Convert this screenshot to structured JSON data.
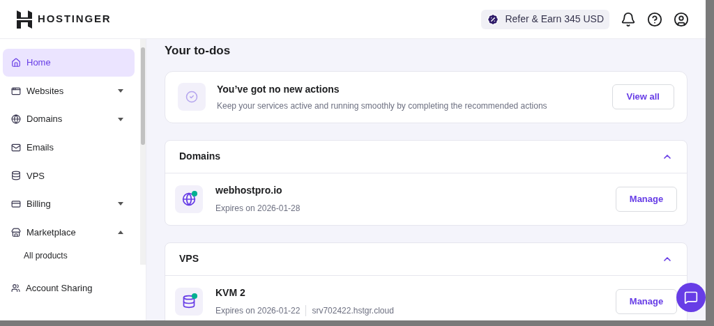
{
  "header": {
    "brand": "HOSTINGER",
    "referral": "Refer & Earn 345 USD"
  },
  "sidebar": {
    "items": [
      {
        "label": "Home",
        "selected": true
      },
      {
        "label": "Websites",
        "selected": false,
        "expanded": false
      },
      {
        "label": "Domains",
        "selected": false,
        "expanded": false
      },
      {
        "label": "Emails",
        "selected": false
      },
      {
        "label": "VPS",
        "selected": false
      },
      {
        "label": "Billing",
        "selected": false,
        "expanded": false
      },
      {
        "label": "Marketplace",
        "selected": false,
        "expanded": true,
        "children": [
          {
            "label": "All products",
            "selected": false
          }
        ]
      }
    ],
    "footer_item": {
      "label": "Account Sharing",
      "selected": false
    }
  },
  "main": {
    "heading": "Your to-dos",
    "todo": {
      "title": "You’ve got no new actions",
      "text": "Keep your services active and running smoothly by completing the recommended actions",
      "button": "View all"
    },
    "sections": [
      {
        "title": "Domains",
        "expanded": true,
        "items": [
          {
            "name": "webhostpro.io",
            "expiry": "Expires on 2026-01-28",
            "color": "#00b090",
            "button": "Manage"
          }
        ]
      },
      {
        "title": "VPS",
        "expanded": true,
        "items": [
          {
            "name": "KVM 2",
            "expiry": "Expires on 2026-01-22",
            "host": "srv702422.hstgr.cloud",
            "color": "#00b090",
            "button": "Manage"
          }
        ]
      }
    ]
  }
}
